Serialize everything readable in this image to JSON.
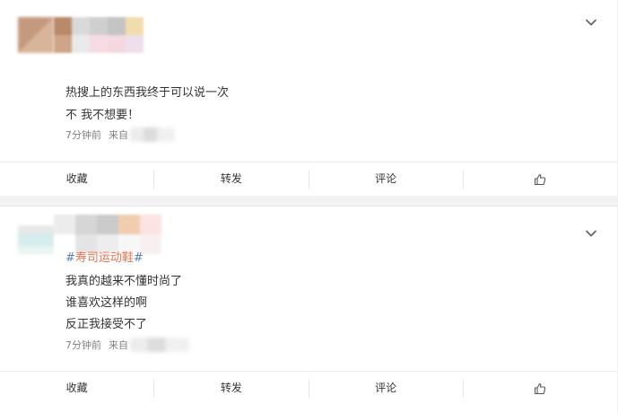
{
  "posts": [
    {
      "lines": [
        "热搜上的东西我终于可以说一次",
        "不 我不想要！"
      ],
      "time": "7分钟前",
      "source_label": "来自"
    },
    {
      "topic": "#寿司运动鞋#",
      "lines": [
        "我真的越来不懂时尚了",
        "谁喜欢这样的啊",
        "反正我接受不了"
      ],
      "time": "7分钟前",
      "source_label": "来自"
    }
  ],
  "actions": {
    "favorite": "收藏",
    "repost": "转发",
    "comment": "评论"
  },
  "icons": {
    "menu": "chevron-down-icon",
    "like": "thumbs-up-icon"
  },
  "colors": {
    "topic_text": "#eb7350",
    "topic_hash": "#5b7fb2",
    "meta": "#808080",
    "page_bg": "#f2f2f5"
  }
}
